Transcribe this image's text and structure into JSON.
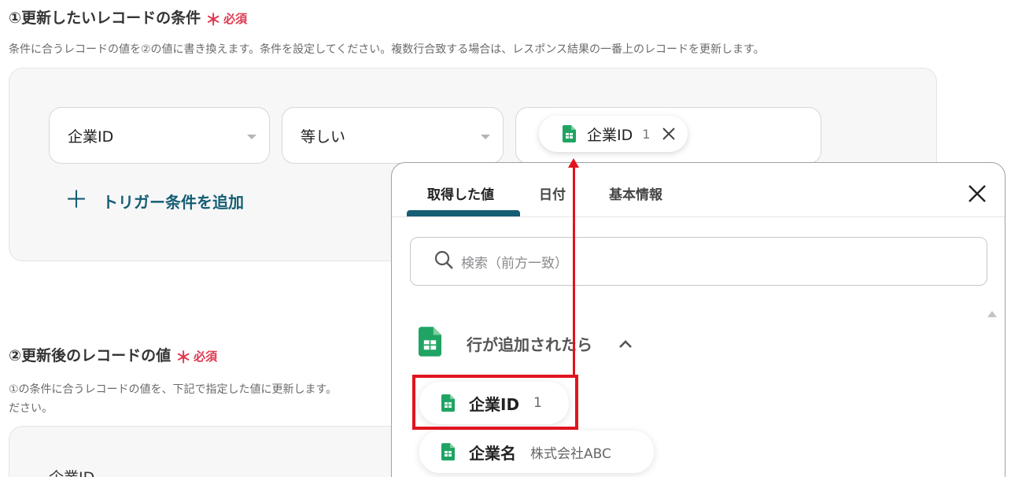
{
  "section1": {
    "title": "①更新したいレコードの条件",
    "required_star": "＊",
    "required": "必須",
    "description": "条件に合うレコードの値を②の値に書き換えます。条件を設定してください。複数行合致する場合は、レスポンス結果の一番上のレコードを更新します。",
    "field_select": "企業ID",
    "operator_select": "等しい",
    "value_chip": {
      "label": "企業ID",
      "number": "1"
    },
    "add_trigger": "トリガー条件を追加",
    "add_icon": "＋"
  },
  "section2": {
    "title": "②更新後のレコードの値",
    "required_star": "＊",
    "required": "必須",
    "description_line1": "①の条件に合うレコードの値を、下記で指定した値に更新します。",
    "description_line2": "ださい。",
    "field_label": "企業ID"
  },
  "popup": {
    "tabs": [
      {
        "label": "取得した値",
        "active": true
      },
      {
        "label": "日付",
        "active": false
      },
      {
        "label": "基本情報",
        "active": false
      }
    ],
    "search_placeholder": "検索（前方一致）",
    "group_label": "行が追加されたら",
    "items": [
      {
        "label": "企業ID",
        "value": "1"
      },
      {
        "label": "企業名",
        "value": "株式会社ABC"
      }
    ]
  },
  "colors": {
    "accent": "#155e73",
    "required": "#e0384f",
    "sheets_green": "#1fa463",
    "annotation_red": "#e1141e"
  },
  "icons": {
    "sheet": "google-sheets-icon",
    "close": "close-icon",
    "search": "search-icon",
    "chevron": "chevron-up-icon",
    "caret": "caret-down-icon"
  }
}
